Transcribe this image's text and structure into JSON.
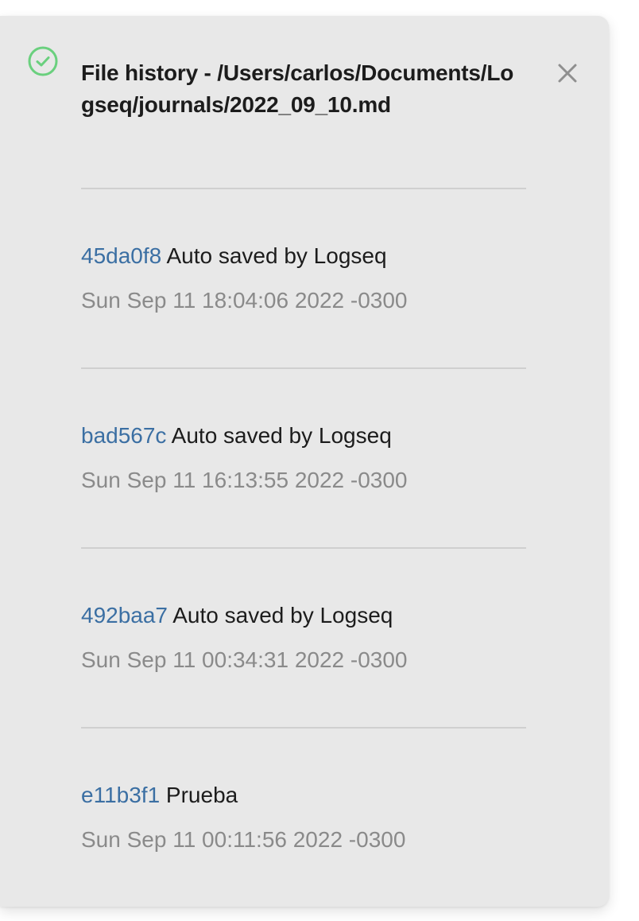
{
  "header": {
    "title": "File history - /Users/carlos/Documents/Logseq/journals/2022_09_10.md",
    "status_icon": "check-circle-icon",
    "close_icon": "close-icon"
  },
  "colors": {
    "panel_bg": "#e8e8e8",
    "hash_link": "#3b6fa3",
    "date_text": "#8a8a8a",
    "check_icon": "#6ad07e"
  },
  "commits": [
    {
      "hash": "45da0f8",
      "message": "Auto saved by Logseq",
      "date": "Sun Sep 11 18:04:06 2022 -0300"
    },
    {
      "hash": "bad567c",
      "message": "Auto saved by Logseq",
      "date": "Sun Sep 11 16:13:55 2022 -0300"
    },
    {
      "hash": "492baa7",
      "message": "Auto saved by Logseq",
      "date": "Sun Sep 11 00:34:31 2022 -0300"
    },
    {
      "hash": "e11b3f1",
      "message": "Prueba",
      "date": "Sun Sep 11 00:11:56 2022 -0300"
    }
  ]
}
